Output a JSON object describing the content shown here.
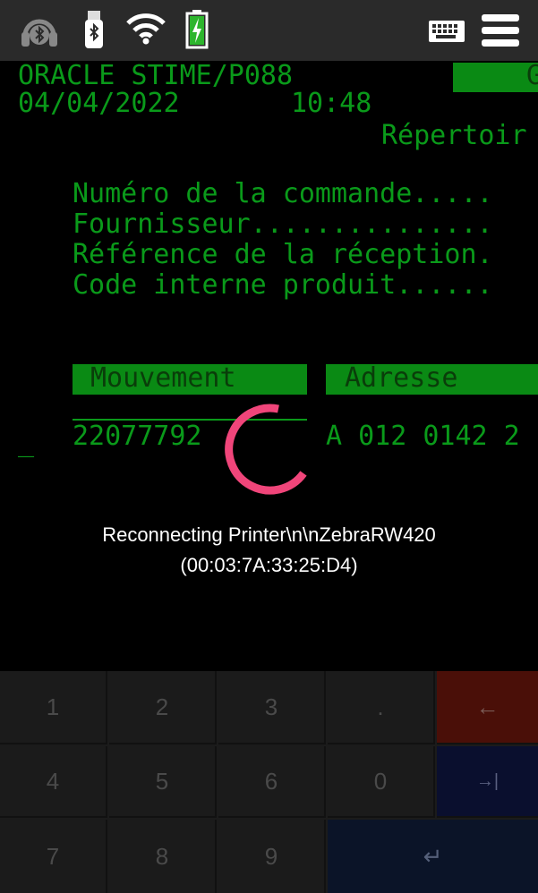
{
  "terminal": {
    "title": "ORACLE STIME/P088",
    "header_right": "G",
    "date": "04/04/2022",
    "time": "10:48",
    "section_title": "Répertoir",
    "fields": [
      "Numéro de la commande.....",
      "Fournisseur...............",
      "Référence de la réception.",
      "Code interne produit......"
    ],
    "col_movement": "Mouvement",
    "col_address": "Adresse",
    "row_movement": "22077792",
    "row_address": "A 012 0142 2",
    "cursor": "_"
  },
  "dialog": {
    "line1": "Reconnecting Printer\\n\\nZebraRW420",
    "line2": "(00:03:7A:33:25:D4)",
    "spinner_color": "#f0457a"
  },
  "status_icons": [
    "headset-bluetooth-icon",
    "bluetooth-usb-icon",
    "wifi-icon",
    "battery-charging-icon",
    "keyboard-icon",
    "menu-icon"
  ],
  "keypad": {
    "keys": [
      "1",
      "2",
      "3",
      ".",
      "←",
      "4",
      "5",
      "6",
      "0",
      "→|",
      "7",
      "8",
      "9",
      "↵"
    ],
    "backspace_color": "#4a0f08",
    "tab_color": "#0a0f2e",
    "enter_color": "#0b1428"
  }
}
